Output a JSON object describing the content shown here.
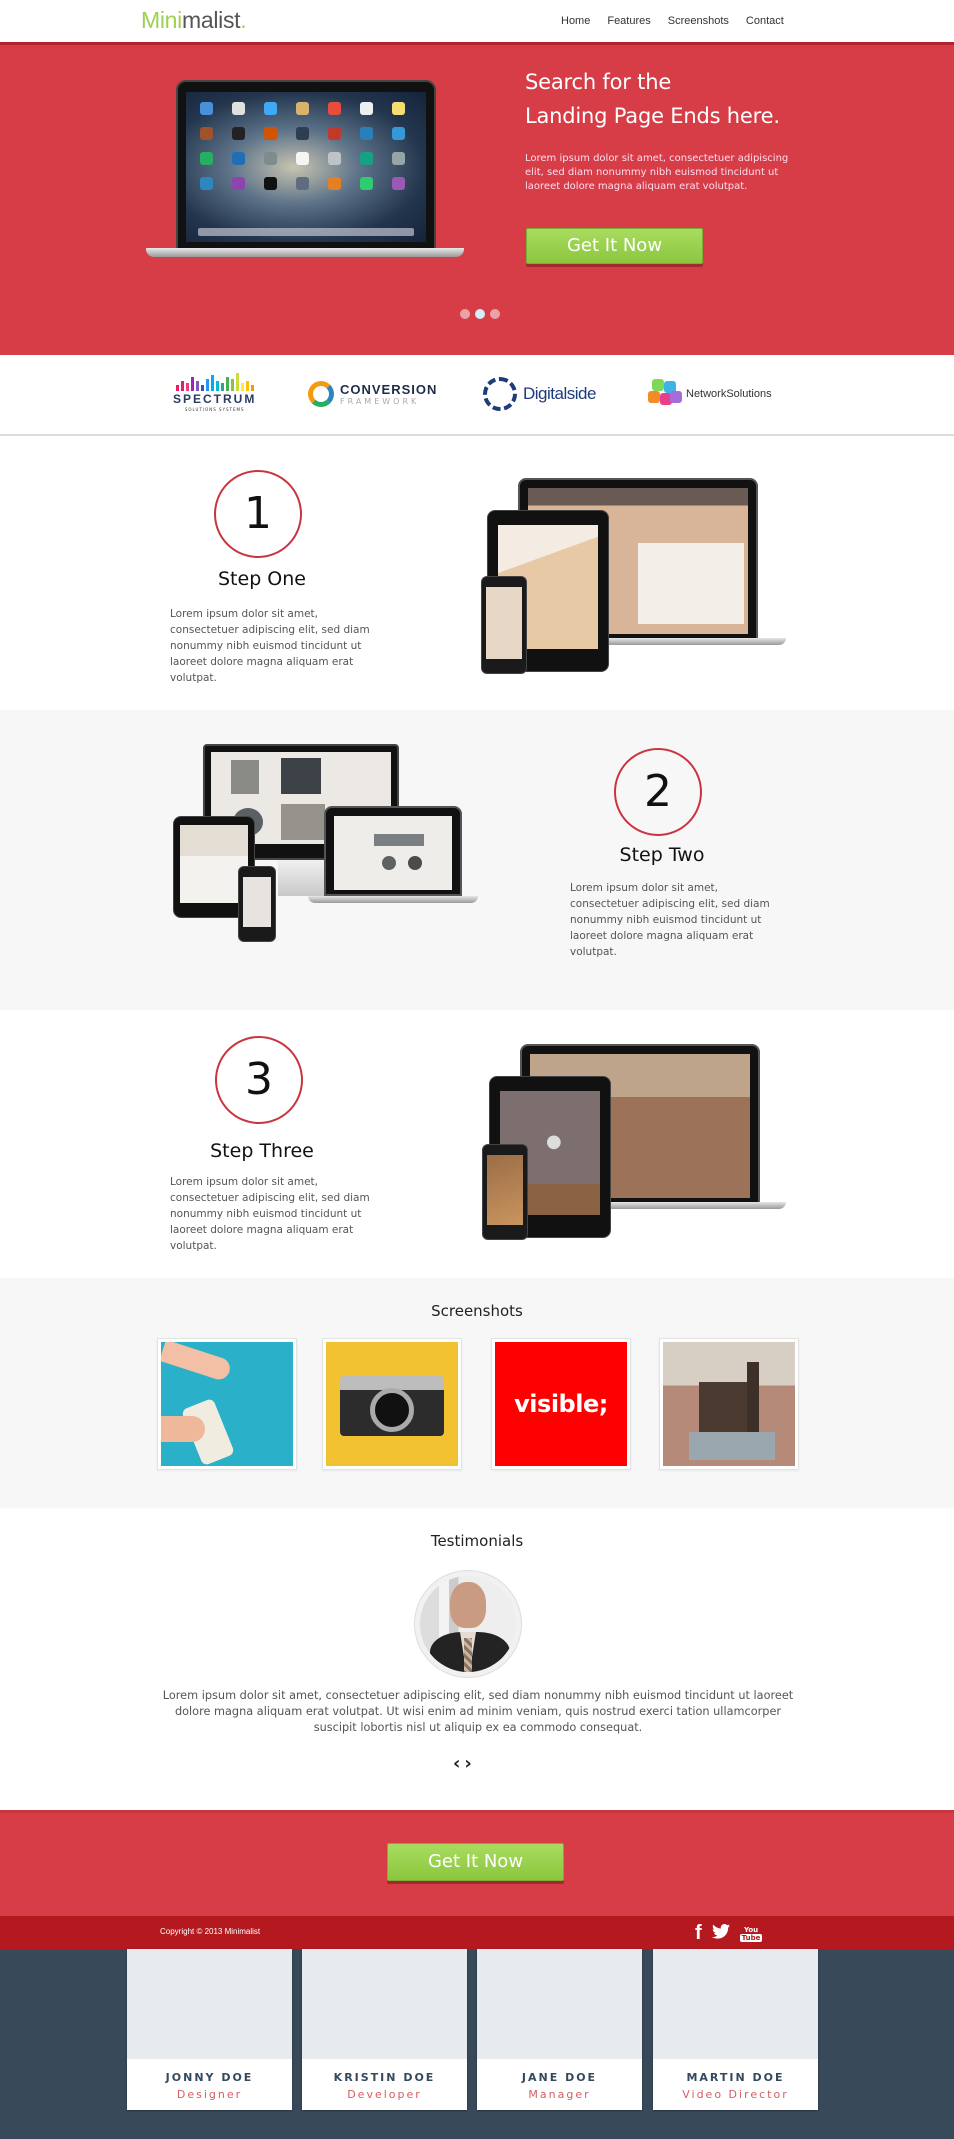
{
  "header": {
    "logo_accent": "Mini",
    "logo_rest": "malist",
    "logo_dot": ".",
    "nav": [
      "Home",
      "Features",
      "Screenshots",
      "Contact"
    ]
  },
  "hero": {
    "title_line1": "Search for the",
    "title_line2": "Landing Page Ends here.",
    "body": "Lorem ipsum dolor sit amet, consectetuer adipiscing elit, sed diam nonummy nibh euismod tincidunt ut laoreet dolore magna aliquam erat volutpat.",
    "cta_label": "Get It Now",
    "slider": {
      "total": 3,
      "active": 2
    }
  },
  "partners": {
    "spectrum": {
      "name": "SPECTRUM",
      "tagline": "SOLUTIONS SYSTEMS"
    },
    "conversion": {
      "name": "CONVERSION",
      "tagline": "FRAMEWORK"
    },
    "digitalside": {
      "name": "Digitalside"
    },
    "network": {
      "name": "NetworkSolutions"
    }
  },
  "steps": [
    {
      "number": "1",
      "title": "Step One",
      "body": "Lorem ipsum dolor sit amet, consectetuer adipiscing elit, sed diam nonummy nibh euismod tincidunt ut laoreet dolore magna aliquam erat volutpat."
    },
    {
      "number": "2",
      "title": "Step Two",
      "body": "Lorem ipsum dolor sit amet, consectetuer adipiscing elit, sed diam nonummy nibh euismod tincidunt ut laoreet dolore magna aliquam erat volutpat."
    },
    {
      "number": "3",
      "title": "Step Three",
      "body": "Lorem ipsum dolor sit amet, consectetuer adipiscing elit, sed diam nonummy nibh euismod tincidunt ut laoreet dolore magna aliquam erat volutpat."
    }
  ],
  "screenshots": {
    "title": "Screenshots",
    "items": [
      {
        "alt": "hand opening beer can"
      },
      {
        "alt": "vintage camera"
      },
      {
        "alt": "visible text",
        "text": "visible;"
      },
      {
        "alt": "street statue with cart"
      }
    ]
  },
  "testimonials": {
    "title": "Testimonials",
    "quote": "Lorem ipsum dolor sit amet, consectetuer adipiscing elit, sed diam nonummy nibh euismod tincidunt ut laoreet dolore magna aliquam erat volutpat. Ut wisi enim ad minim veniam, quis nostrud exerci tation ullamcorper suscipit lobortis nisl ut aliquip ex ea commodo consequat.",
    "prev": "‹",
    "next": "›"
  },
  "cta": {
    "label": "Get It Now"
  },
  "footer": {
    "copyright": "Copyright © 2013 Minimalist",
    "social": {
      "facebook": "f",
      "twitter": "🐦",
      "youtube_top": "You",
      "youtube_bottom": "Tube"
    }
  },
  "team": [
    {
      "name": "JONNY DOE",
      "role": "Designer"
    },
    {
      "name": "KRISTIN DOE",
      "role": "Developer"
    },
    {
      "name": "JANE DOE",
      "role": "Manager"
    },
    {
      "name": "MARTIN DOE",
      "role": "Video Director"
    }
  ],
  "colors": {
    "brand_red": "#d63d47",
    "dark_red": "#b3191f",
    "accent_green": "#8cc63f",
    "navy": "#384a5a"
  }
}
